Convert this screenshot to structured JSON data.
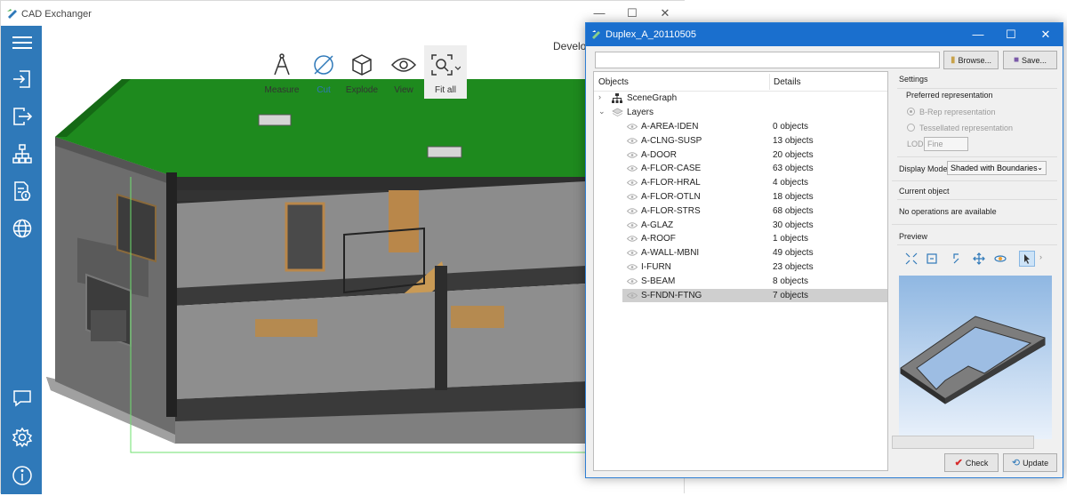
{
  "main_window": {
    "title": "CAD Exchanger",
    "controls": {
      "minimize": "—",
      "maximize": "☐",
      "close": "✕"
    },
    "sidebar": [
      {
        "icon": "menu-icon"
      },
      {
        "icon": "import-icon"
      },
      {
        "icon": "export-icon"
      },
      {
        "icon": "structure-icon"
      },
      {
        "icon": "report-icon"
      },
      {
        "icon": "web-icon"
      },
      {
        "icon": "chat-icon"
      },
      {
        "icon": "settings-icon"
      },
      {
        "icon": "info-icon"
      }
    ],
    "toolbar": {
      "measure": "Measure",
      "cut": "Cut",
      "explode": "Explode",
      "view": "View",
      "fit_all": "Fit all"
    },
    "partial_label": "Develop",
    "accent_color": "#2f79b9"
  },
  "dialog": {
    "title": "Duplex_A_20110505",
    "controls": {
      "minimize": "—",
      "maximize": "☐",
      "close": "✕"
    },
    "browse_label": "Browse...",
    "save_label": "Save...",
    "tree": {
      "col_objects": "Objects",
      "col_details": "Details",
      "scene_graph": "SceneGraph",
      "layers": "Layers",
      "rows": [
        {
          "name": "A-AREA-IDEN",
          "details": "0 objects"
        },
        {
          "name": "A-CLNG-SUSP",
          "details": "13 objects"
        },
        {
          "name": "A-DOOR",
          "details": "20 objects"
        },
        {
          "name": "A-FLOR-CASE",
          "details": "63 objects"
        },
        {
          "name": "A-FLOR-HRAL",
          "details": "4 objects"
        },
        {
          "name": "A-FLOR-OTLN",
          "details": "18 objects"
        },
        {
          "name": "A-FLOR-STRS",
          "details": "68 objects"
        },
        {
          "name": "A-GLAZ",
          "details": "30 objects"
        },
        {
          "name": "A-ROOF",
          "details": "1 objects"
        },
        {
          "name": "A-WALL-MBNI",
          "details": "49 objects"
        },
        {
          "name": "I-FURN",
          "details": "23 objects"
        },
        {
          "name": "S-BEAM",
          "details": "8 objects"
        },
        {
          "name": "S-FNDN-FTNG",
          "details": "7 objects",
          "selected": true
        }
      ]
    },
    "settings": {
      "heading": "Settings",
      "preferred_rep": "Preferred representation",
      "brep": "B-Rep representation",
      "tessellated": "Tessellated representation",
      "lod_label": "LOD",
      "lod_value": "Fine",
      "display_mode_label": "Display Mode",
      "display_mode_value": "Shaded with Boundaries",
      "current_object": "Current object",
      "no_ops": "No operations are available",
      "preview": "Preview"
    },
    "check_label": "Check",
    "update_label": "Update",
    "accent_color": "#1a6fce"
  }
}
